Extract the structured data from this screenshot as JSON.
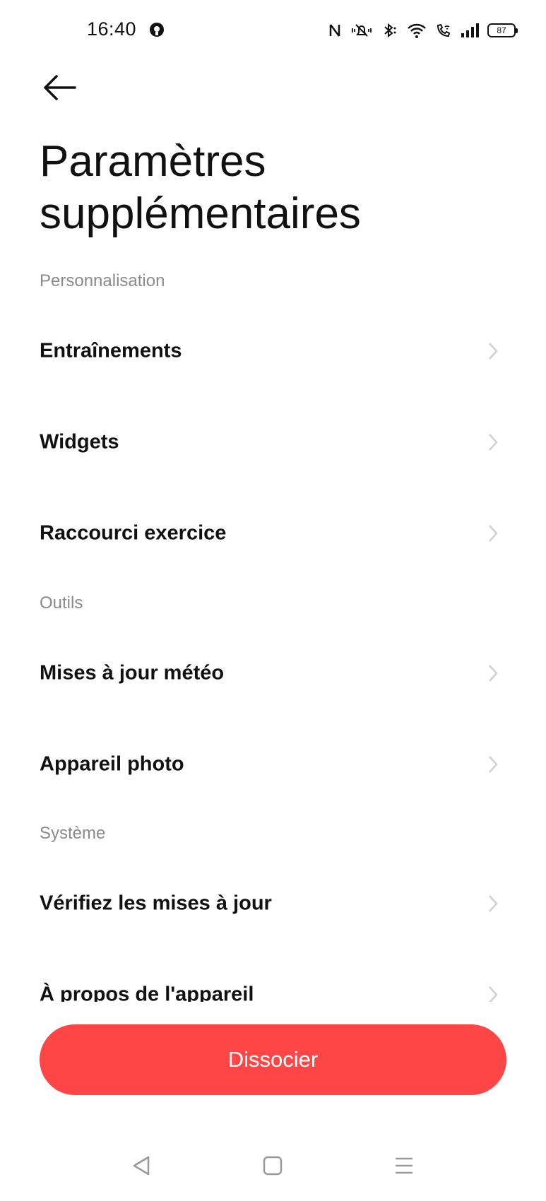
{
  "status_bar": {
    "time": "16:40",
    "battery_level": "87",
    "icons": [
      "app-notification-icon",
      "nfc-icon",
      "mute-icon",
      "bluetooth-icon",
      "wifi-icon",
      "wifi-calling-icon",
      "signal-icon",
      "battery-icon"
    ]
  },
  "header": {
    "back_icon": "arrow-left-icon",
    "title": "Paramètres supplémentaires"
  },
  "sections": [
    {
      "title": "Personnalisation",
      "items": [
        {
          "label": "Entraînements"
        },
        {
          "label": "Widgets"
        },
        {
          "label": "Raccourci exercice"
        }
      ]
    },
    {
      "title": "Outils",
      "items": [
        {
          "label": "Mises à jour météo"
        },
        {
          "label": "Appareil photo"
        }
      ]
    },
    {
      "title": "Système",
      "items": [
        {
          "label": "Vérifiez les mises à jour"
        },
        {
          "label": "À propos de l'appareil"
        }
      ]
    }
  ],
  "footer": {
    "unpair_label": "Dissocier",
    "unpair_color": "#ff4646"
  },
  "nav_bar": {
    "icons": [
      "nav-back-icon",
      "nav-home-icon",
      "nav-menu-icon"
    ]
  }
}
